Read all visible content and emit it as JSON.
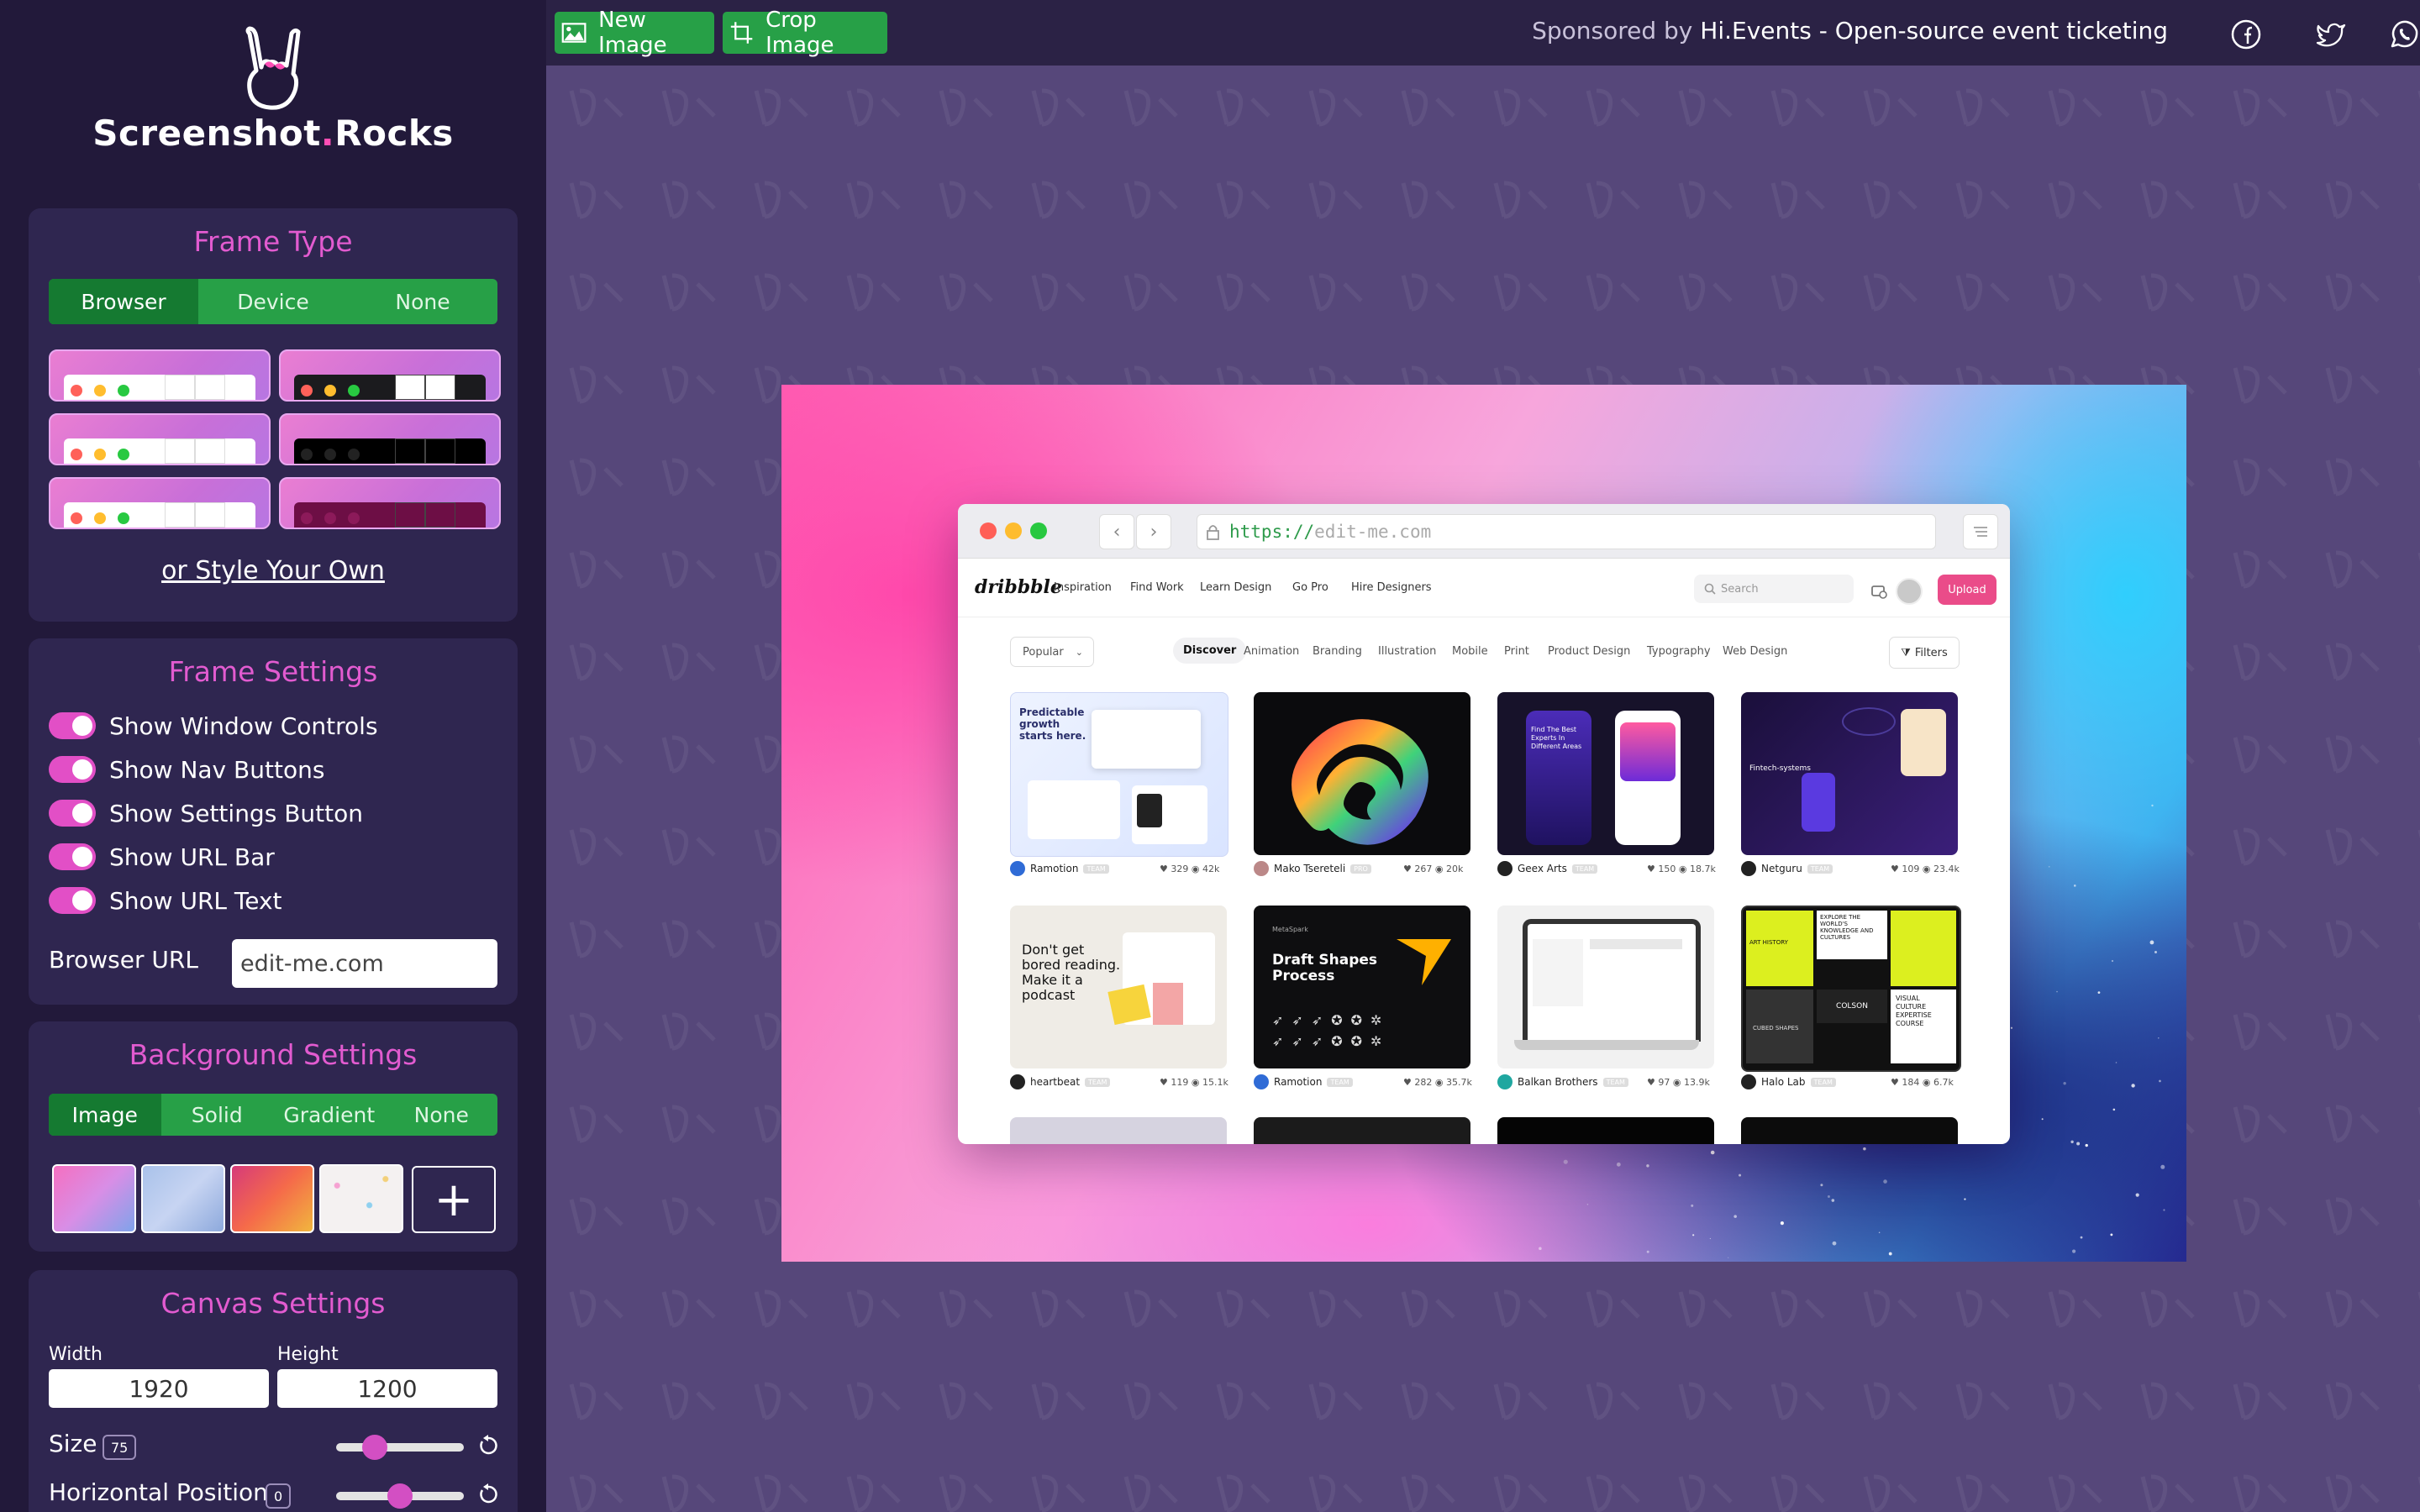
{
  "app": {
    "logo_text_main": "Screenshot",
    "logo_text_dot": ".",
    "logo_text_end": "Rocks"
  },
  "frame_type": {
    "title": "Frame Type",
    "tabs": [
      "Browser",
      "Device",
      "None"
    ],
    "active_tab": "Browser",
    "style_own": "or Style Your Own"
  },
  "frame_settings": {
    "title": "Frame Settings",
    "toggles": [
      {
        "label": "Show Window Controls",
        "on": true
      },
      {
        "label": "Show Nav Buttons",
        "on": true
      },
      {
        "label": "Show Settings Button",
        "on": true
      },
      {
        "label": "Show URL Bar",
        "on": true
      },
      {
        "label": "Show URL Text",
        "on": true
      }
    ],
    "url_label": "Browser URL",
    "url_value": "edit-me.com"
  },
  "background_settings": {
    "title": "Background Settings",
    "tabs": [
      "Image",
      "Solid",
      "Gradient",
      "None"
    ],
    "active_tab": "Image",
    "add_symbol": "+"
  },
  "canvas_settings": {
    "title": "Canvas Settings",
    "width_label": "Width",
    "width_value": "1920",
    "height_label": "Height",
    "height_value": "1200",
    "size_label": "Size",
    "size_value": "75",
    "size_fraction": 0.3,
    "hpos_label": "Horizontal Position",
    "hpos_value": "0",
    "hpos_fraction": 0.5
  },
  "toolbar": {
    "new_image": "New Image",
    "crop_image": "Crop Image",
    "sponsor_prefix": "Sponsored by",
    "sponsor_name": "Hi.Events - Open-source event ticketing"
  },
  "preview": {
    "url_scheme": "https://",
    "url_host": "edit-me.com",
    "site_logo": "dribbble",
    "nav_links": [
      "Inspiration",
      "Find Work",
      "Learn Design",
      "Go Pro",
      "Hire Designers"
    ],
    "search_placeholder": "Search",
    "upload_label": "Upload",
    "sort_label": "Popular",
    "categories": [
      "Discover",
      "Animation",
      "Branding",
      "Illustration",
      "Mobile",
      "Print",
      "Product Design",
      "Typography",
      "Web Design"
    ],
    "filters_label": "Filters",
    "shots": [
      {
        "author": "Ramotion",
        "badge": "TEAM",
        "likes": "329",
        "views": "42k",
        "caption": "Predictable growth starts here."
      },
      {
        "author": "Mako Tsereteli",
        "badge": "PRO",
        "likes": "267",
        "views": "20k",
        "caption": ""
      },
      {
        "author": "Geex Arts",
        "badge": "TEAM",
        "likes": "150",
        "views": "18.7k",
        "caption": "Find The Best Experts In Different Areas"
      },
      {
        "author": "Netguru",
        "badge": "TEAM",
        "likes": "109",
        "views": "23.4k",
        "caption": "Fintech-systems"
      },
      {
        "author": "heartbeat",
        "badge": "TEAM",
        "likes": "119",
        "views": "15.1k",
        "caption": "Don't get bored reading. Make it a podcast"
      },
      {
        "author": "Ramotion",
        "badge": "TEAM",
        "likes": "282",
        "views": "35.7k",
        "caption": "Draft Shapes Process"
      },
      {
        "author": "Balkan Brothers",
        "badge": "TEAM",
        "likes": "97",
        "views": "13.9k",
        "caption": ""
      },
      {
        "author": "Halo Lab",
        "badge": "TEAM",
        "likes": "184",
        "views": "6.7k",
        "caption": "VISUAL CULTURE EXPERTISE COURSE"
      }
    ],
    "shot6_brand": "MetaSpark",
    "shot8_top": "EXPLORE THE WORLD'S KNOWLEDGE AND CULTURES",
    "shot8_art": "ART HISTORY",
    "shot8_code": "COLSON",
    "shot8_cube": "CUBED SHAPES"
  },
  "colors": {
    "sidebar_bg": "#22193a",
    "panel_bg": "#2f2650",
    "accent_pink": "#e25bd0",
    "accent_green": "#27a047",
    "stage_bg": "#56477a"
  }
}
